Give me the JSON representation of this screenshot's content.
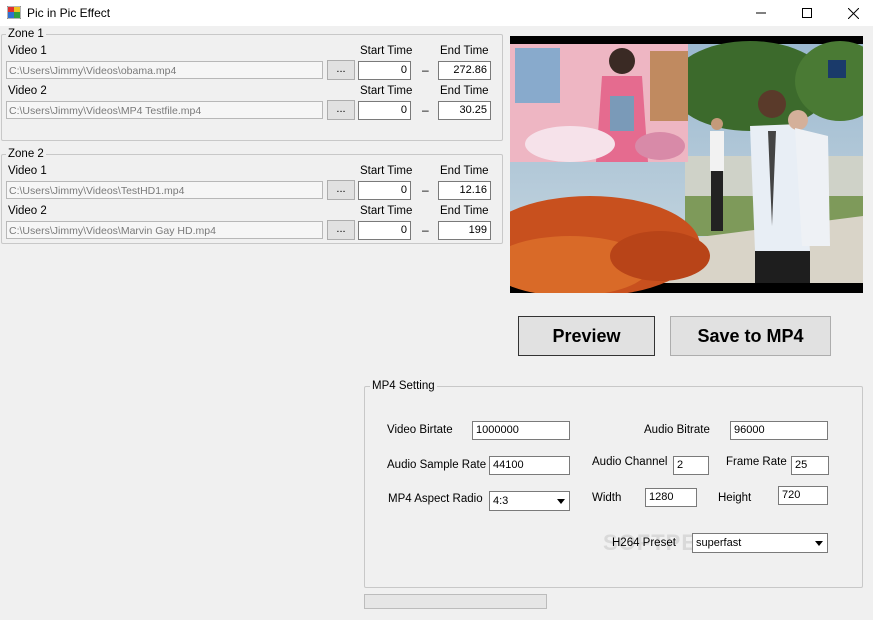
{
  "window": {
    "title": "Pic in Pic Effect"
  },
  "zones": [
    {
      "label": "Zone 1",
      "videos": [
        {
          "label": "Video 1",
          "path": "C:\\Users\\Jimmy\\Videos\\obama.mp4",
          "start": "0",
          "end": "272.86"
        },
        {
          "label": "Video 2",
          "path": "C:\\Users\\Jimmy\\Videos\\MP4 Testfile.mp4",
          "start": "0",
          "end": "30.25"
        }
      ]
    },
    {
      "label": "Zone 2",
      "videos": [
        {
          "label": "Video 1",
          "path": "C:\\Users\\Jimmy\\Videos\\TestHD1.mp4",
          "start": "0",
          "end": "12.16"
        },
        {
          "label": "Video 2",
          "path": "C:\\Users\\Jimmy\\Videos\\Marvin Gay HD.mp4",
          "start": "0",
          "end": "199"
        }
      ]
    }
  ],
  "labels": {
    "start_time": "Start Time",
    "end_time": "End Time",
    "browse": "...",
    "dash": "–"
  },
  "buttons": {
    "preview": "Preview",
    "save": "Save to MP4"
  },
  "mp4_setting": {
    "title": "MP4 Setting",
    "video_bitrate_label": "Video Birtate",
    "video_bitrate": "1000000",
    "audio_bitrate_label": "Audio Bitrate",
    "audio_bitrate": "96000",
    "audio_sample_rate_label": "Audio Sample Rate",
    "audio_sample_rate": "44100",
    "audio_channel_label": "Audio Channel",
    "audio_channel": "2",
    "frame_rate_label": "Frame Rate",
    "frame_rate": "25",
    "aspect_label": "MP4 Aspect Radio",
    "aspect": "4:3",
    "width_label": "Width",
    "width": "1280",
    "height_label": "Height",
    "height": "720",
    "preset_label": "H264 Preset",
    "preset": "superfast"
  },
  "progress": {
    "value": 0
  },
  "watermark": "SOFTPEDIA",
  "colors": {
    "progress": "#06b025",
    "titlebar": "#ffffff",
    "background": "#f0f0f0"
  }
}
